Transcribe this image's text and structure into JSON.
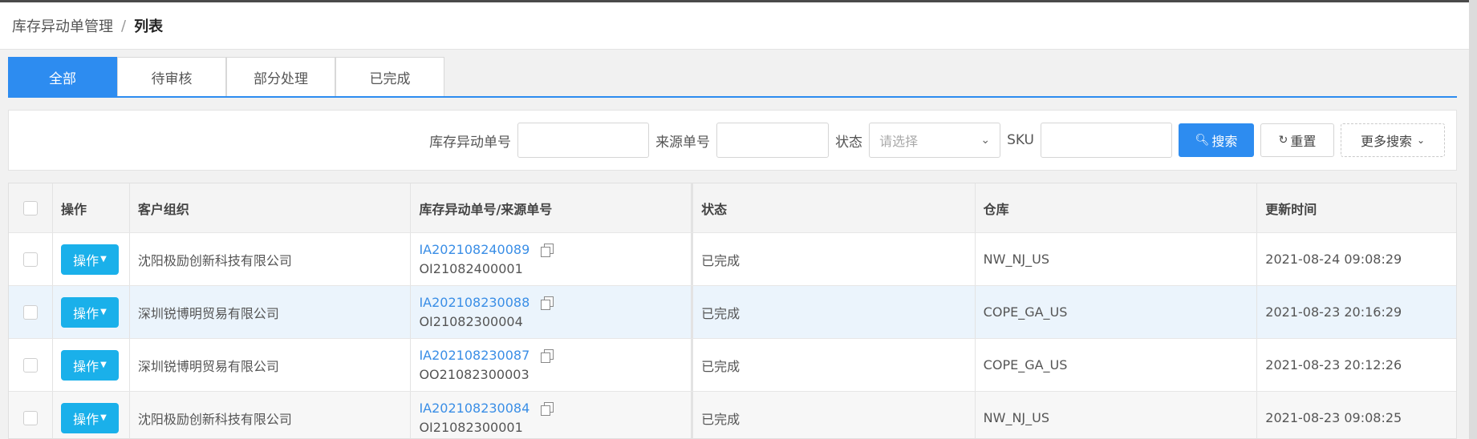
{
  "breadcrumb": {
    "parent": "库存异动单管理",
    "separator": "/",
    "current": "列表"
  },
  "tabs": [
    {
      "label": "全部",
      "active": true
    },
    {
      "label": "待审核",
      "active": false
    },
    {
      "label": "部分处理",
      "active": false
    },
    {
      "label": "已完成",
      "active": false
    }
  ],
  "search": {
    "adjust_no_label": "库存异动单号",
    "adjust_no_value": "",
    "source_no_label": "来源单号",
    "source_no_value": "",
    "status_label": "状态",
    "status_placeholder": "请选择",
    "sku_label": "SKU",
    "sku_value": "",
    "search_button": "搜索",
    "reset_button": "重置",
    "more_button": "更多搜索"
  },
  "table": {
    "columns": [
      "操作",
      "客户组织",
      "库存异动单号/来源单号",
      "状态",
      "仓库",
      "更新时间"
    ],
    "action_label": "操作",
    "rows": [
      {
        "org": "沈阳极励创新科技有限公司",
        "adjust_no": "IA202108240089",
        "source_no": "OI21082400001",
        "status": "已完成",
        "warehouse": "NW_NJ_US",
        "updated": "2021-08-24 09:08:29"
      },
      {
        "org": "深圳锐博明贸易有限公司",
        "adjust_no": "IA202108230088",
        "source_no": "OI21082300004",
        "status": "已完成",
        "warehouse": "COPE_GA_US",
        "updated": "2021-08-23 20:16:29"
      },
      {
        "org": "深圳锐博明贸易有限公司",
        "adjust_no": "IA202108230087",
        "source_no": "OO21082300003",
        "status": "已完成",
        "warehouse": "COPE_GA_US",
        "updated": "2021-08-23 20:12:26"
      },
      {
        "org": "沈阳极励创新科技有限公司",
        "adjust_no": "IA202108230084",
        "source_no": "OI21082300001",
        "status": "已完成",
        "warehouse": "NW_NJ_US",
        "updated": "2021-08-23 09:08:25"
      }
    ]
  },
  "colors": {
    "primary": "#2d8cf0",
    "action": "#1ab0ea",
    "link": "#3a8ee6",
    "row_highlight": "#ebf4fc"
  }
}
